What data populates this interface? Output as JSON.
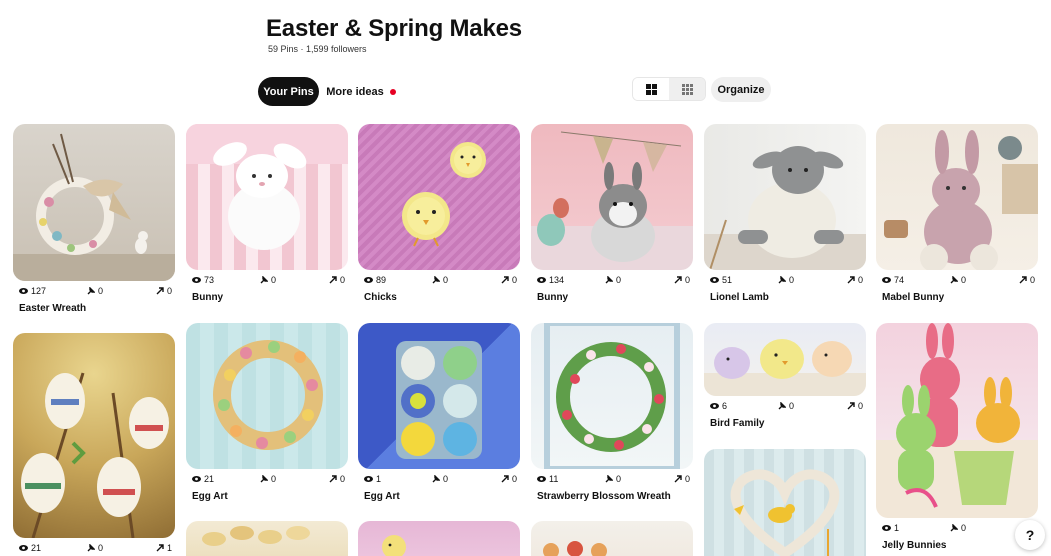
{
  "board": {
    "title": "Easter & Spring Makes",
    "meta": "59 Pins · 1,599 followers"
  },
  "tabs": {
    "your_pins": "Your Pins",
    "more_ideas": "More ideas"
  },
  "toolbar": {
    "organize": "Organize",
    "view_default_icon": "grid-large-icon",
    "view_compact_icon": "grid-compact-icon"
  },
  "colors": {
    "accent_red": "#e60023",
    "dark_pill": "#111111",
    "light_pill": "#efefef"
  },
  "pins": [
    {
      "title": "Easter Wreath",
      "views": "127",
      "saves": "0",
      "shares": "0"
    },
    {
      "title": "Bunny",
      "views": "73",
      "saves": "0",
      "shares": "0"
    },
    {
      "title": "Chicks",
      "views": "89",
      "saves": "0",
      "shares": "0"
    },
    {
      "title": "Bunny",
      "views": "134",
      "saves": "0",
      "shares": "0"
    },
    {
      "title": "Lionel Lamb",
      "views": "51",
      "saves": "0",
      "shares": "0"
    },
    {
      "title": "Mabel Bunny",
      "views": "74",
      "saves": "0",
      "shares": "0"
    },
    {
      "title": "",
      "views": "21",
      "saves": "0",
      "shares": "1"
    },
    {
      "title": "Egg Art",
      "views": "21",
      "saves": "0",
      "shares": "0"
    },
    {
      "title": "Egg Art",
      "views": "1",
      "saves": "0",
      "shares": "0"
    },
    {
      "title": "Strawberry Blossom Wreath",
      "views": "11",
      "saves": "0",
      "shares": "0"
    },
    {
      "title": "Bird Family",
      "views": "6",
      "saves": "0",
      "shares": "0"
    },
    {
      "title": "Jelly Bunnies",
      "views": "1",
      "saves": "0",
      "shares": ""
    }
  ],
  "help": {
    "label": "?"
  }
}
